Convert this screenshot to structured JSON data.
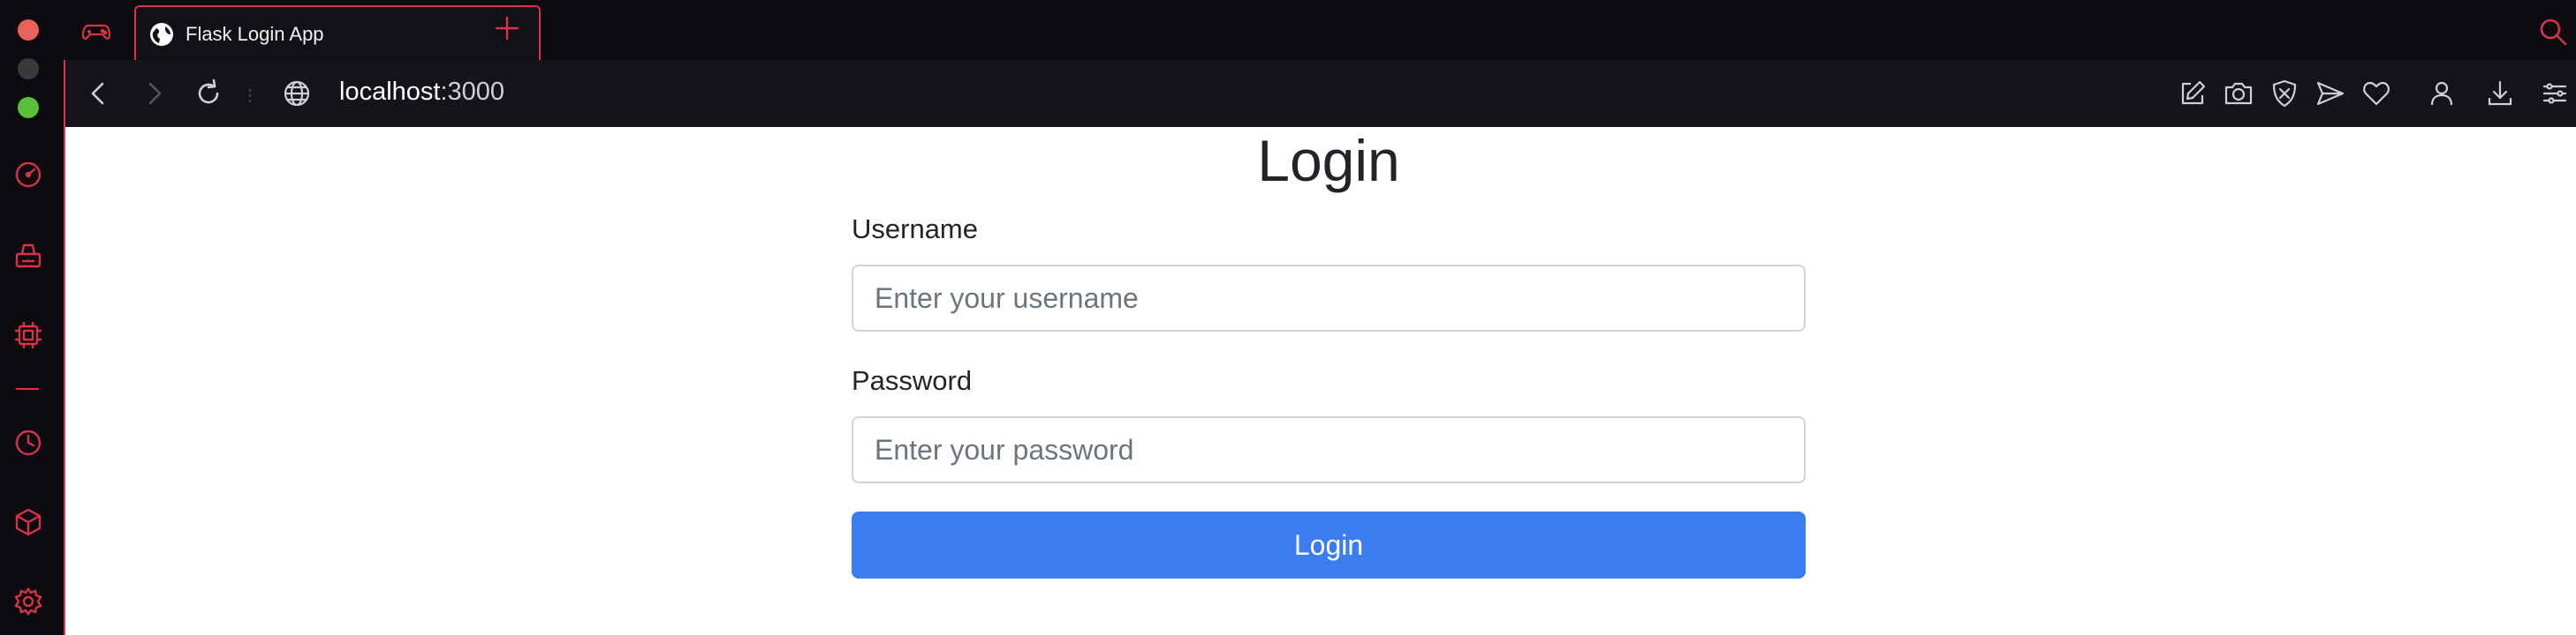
{
  "browser": {
    "tab": {
      "title": "Flask Login App"
    },
    "address": {
      "host": "localhost",
      "port": ":3000"
    },
    "accent_color": "#d9334a"
  },
  "sidebar": {
    "icons": [
      "speedometer-icon",
      "brush-icon",
      "chip-icon",
      "history-icon",
      "cube-icon",
      "settings-icon"
    ]
  },
  "form": {
    "heading": "Login",
    "username": {
      "label": "Username",
      "placeholder": "Enter your username",
      "value": ""
    },
    "password": {
      "label": "Password",
      "placeholder": "Enter your password",
      "value": ""
    },
    "submit_label": "Login",
    "button_color": "#3a7df0"
  }
}
